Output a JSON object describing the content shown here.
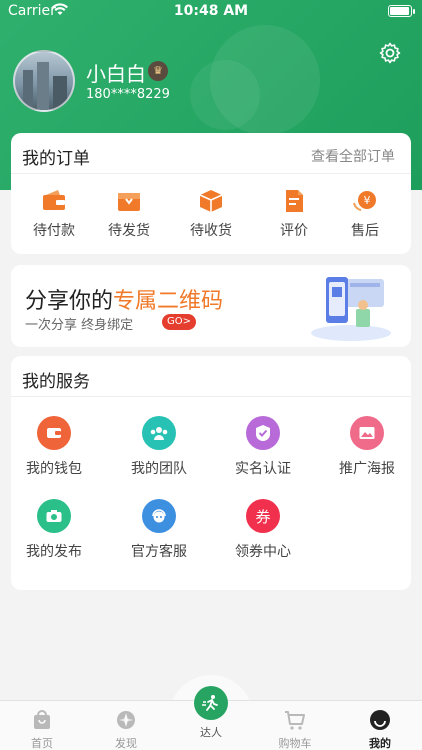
{
  "status_bar": {
    "carrier": "Carrier",
    "time": "10:48 AM"
  },
  "profile": {
    "name": "小白白",
    "vip_badge": "VIP",
    "phone": "180****8229"
  },
  "orders": {
    "title": "我的订单",
    "view_all": "查看全部订单",
    "items": [
      {
        "label": "待付款",
        "icon": "wallet-icon"
      },
      {
        "label": "待发货",
        "icon": "box-icon"
      },
      {
        "label": "待收货",
        "icon": "package-icon"
      },
      {
        "label": "评价",
        "icon": "review-icon"
      },
      {
        "label": "售后",
        "icon": "refund-icon"
      }
    ]
  },
  "banner": {
    "title_main": "分享你的",
    "title_highlight": "专属二维码",
    "subtitle": "一次分享   终身绑定",
    "go_label": "GO>"
  },
  "services": {
    "title": "我的服务",
    "items": [
      {
        "label": "我的钱包",
        "icon": "wallet-icon",
        "color": "#f0643a",
        "glyph": "▭"
      },
      {
        "label": "我的团队",
        "icon": "team-icon",
        "color": "#27c2b4",
        "glyph": "⚇"
      },
      {
        "label": "实名认证",
        "icon": "verified-icon",
        "color": "#b86ad8",
        "glyph": "✓"
      },
      {
        "label": "推广海报",
        "icon": "poster-icon",
        "color": "#f06a8a",
        "glyph": "▨"
      },
      {
        "label": "我的发布",
        "icon": "camera-icon",
        "color": "#2bbf8a",
        "glyph": "◉"
      },
      {
        "label": "官方客服",
        "icon": "customer-service-icon",
        "color": "#3d8fe0",
        "glyph": "☺"
      },
      {
        "label": "领券中心",
        "icon": "coupon-icon",
        "color": "#f0304c",
        "glyph": "券"
      }
    ]
  },
  "tabbar": {
    "items": [
      {
        "label": "首页",
        "icon": "home-bag-icon"
      },
      {
        "label": "发现",
        "icon": "discover-icon"
      },
      {
        "label": "达人",
        "icon": "runner-icon"
      },
      {
        "label": "购物车",
        "icon": "cart-icon"
      },
      {
        "label": "我的",
        "icon": "profile-icon"
      }
    ],
    "active": "我的"
  },
  "colors": {
    "brand_green": "#27a462",
    "highlight_orange": "#f07a2a",
    "go_red": "#e53d2e"
  }
}
